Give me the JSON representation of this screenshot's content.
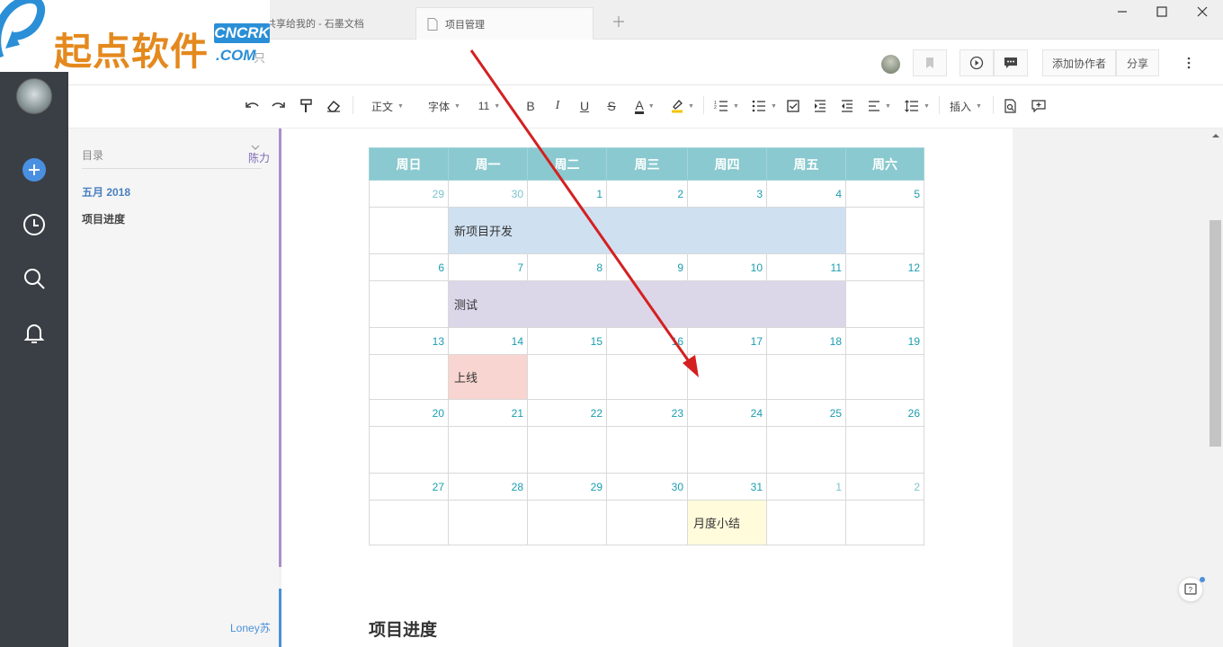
{
  "tabs": [
    {
      "label": "共享给我的 - 石墨文档"
    },
    {
      "label": "项目管理"
    }
  ],
  "watermark": {
    "cn": "起点软件",
    "en1": "CNCRK",
    "en2": ".COM",
    "en3": "只"
  },
  "header": {
    "add_collaborator": "添加协作者",
    "share": "分享"
  },
  "toolbar": {
    "paragraph": "正文",
    "font": "字体",
    "font_size": "11",
    "bold": "B",
    "italic": "I",
    "underline": "U",
    "strike": "S",
    "font_color": "A",
    "insert": "插入"
  },
  "toc": {
    "title": "目录",
    "collaborator": "陈力",
    "items": [
      {
        "label": "五月 2018"
      },
      {
        "label": "项目进度"
      }
    ],
    "bottom_collaborator": "Loney苏"
  },
  "calendar": {
    "weekdays": [
      "周日",
      "周一",
      "周二",
      "周三",
      "周四",
      "周五",
      "周六"
    ],
    "weeks": [
      {
        "dates": [
          "29",
          "30",
          "1",
          "2",
          "3",
          "4",
          "5"
        ],
        "event": "新项目开发"
      },
      {
        "dates": [
          "6",
          "7",
          "8",
          "9",
          "10",
          "11",
          "12"
        ],
        "event": "测试"
      },
      {
        "dates": [
          "13",
          "14",
          "15",
          "16",
          "17",
          "18",
          "19"
        ],
        "event": "上线"
      },
      {
        "dates": [
          "20",
          "21",
          "22",
          "23",
          "24",
          "25",
          "26"
        ],
        "event": ""
      },
      {
        "dates": [
          "27",
          "28",
          "29",
          "30",
          "31",
          "1",
          "2"
        ],
        "event": "月度小结"
      }
    ]
  },
  "doc": {
    "heading": "项目进度"
  },
  "colors": {
    "header_bg": "#8ac9cf",
    "event_blue": "#cfe0f1",
    "event_purple": "#dcd6e9",
    "event_pink": "#f8d5d0",
    "event_yellow": "#fffbdb",
    "annotation_arrow": "#d42020"
  }
}
